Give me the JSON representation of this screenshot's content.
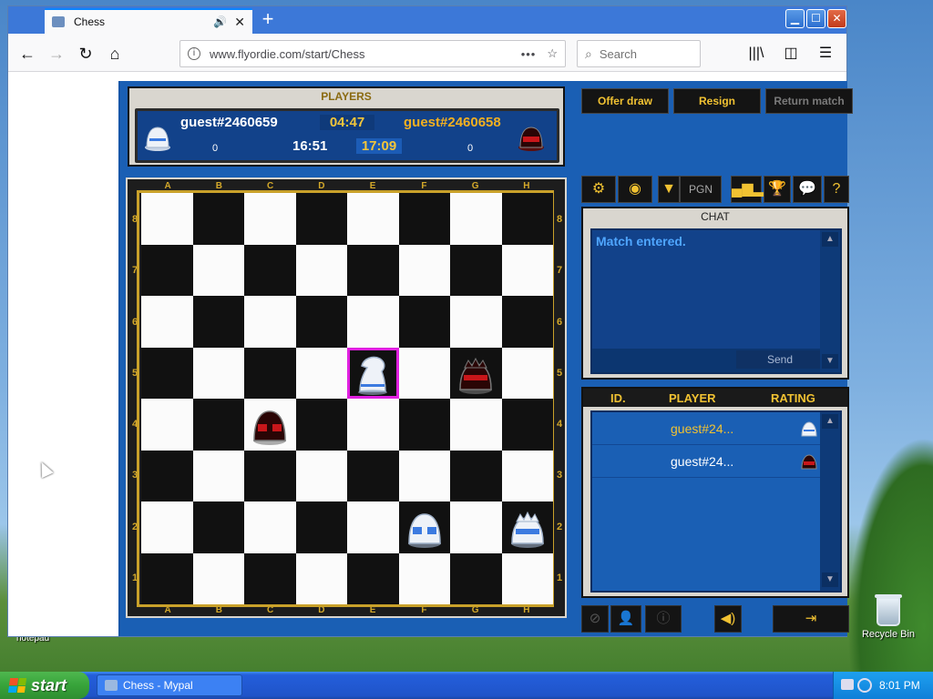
{
  "browser": {
    "tab_title": "Chess",
    "url": "www.flyordie.com/start/Chess",
    "search_placeholder": "Search"
  },
  "players": {
    "title": "PLAYERS",
    "p1": {
      "name": "guest#2460659",
      "score": "0",
      "color": "white"
    },
    "p2": {
      "name": "guest#2460658",
      "score": "0",
      "color": "red"
    },
    "timer_top": "04:47",
    "timer_p1": "16:51",
    "timer_p2": "17:09"
  },
  "actions": {
    "offer_draw": "Offer draw",
    "resign": "Resign",
    "return_match": "Return match"
  },
  "toolbar": {
    "pgn": "PGN"
  },
  "board": {
    "files": [
      "A",
      "B",
      "C",
      "D",
      "E",
      "F",
      "G",
      "H"
    ],
    "ranks": [
      "8",
      "7",
      "6",
      "5",
      "4",
      "3",
      "2",
      "1"
    ],
    "highlight": "e5",
    "pieces": [
      {
        "square": "e5",
        "color": "white",
        "type": "knight"
      },
      {
        "square": "g5",
        "color": "red",
        "type": "king"
      },
      {
        "square": "c4",
        "color": "red",
        "type": "pawn"
      },
      {
        "square": "f2",
        "color": "white",
        "type": "pawn"
      },
      {
        "square": "h2",
        "color": "white",
        "type": "king"
      }
    ]
  },
  "chat": {
    "title": "CHAT",
    "messages": [
      "Match entered."
    ],
    "send_label": "Send"
  },
  "player_list": {
    "headers": {
      "id": "ID.",
      "player": "PLAYER",
      "rating": "RATING"
    },
    "rows": [
      {
        "name": "guest#24...",
        "color": "white"
      },
      {
        "name": "guest#24...",
        "color": "red"
      }
    ]
  },
  "desktop": {
    "recycle_bin": "Recycle Bin",
    "notepad": "notepad"
  },
  "taskbar": {
    "start": "start",
    "item": "Chess - Mypal",
    "time": "8:01 PM"
  },
  "colors": {
    "panel_blue": "#1a5fb4",
    "gold": "#f1c232",
    "highlight": "#e020e0"
  }
}
